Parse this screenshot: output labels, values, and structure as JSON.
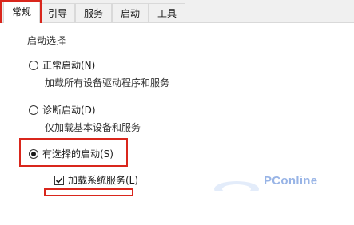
{
  "tabs": [
    {
      "label": "常规",
      "active": true
    },
    {
      "label": "引导"
    },
    {
      "label": "服务"
    },
    {
      "label": "启动"
    },
    {
      "label": "工具"
    }
  ],
  "startup_group": {
    "title": "启动选择",
    "options": [
      {
        "label": "正常启动(N)",
        "description": "加载所有设备驱动程序和服务",
        "checked": false
      },
      {
        "label": "诊断启动(D)",
        "description": "仅加载基本设备和服务",
        "checked": false
      },
      {
        "label": "有选择的启动(S)",
        "checked": true
      }
    ],
    "sub_options": [
      {
        "label": "加载系统服务(L)",
        "checked": true
      }
    ]
  },
  "watermark": {
    "text": "PConline"
  },
  "colors": {
    "highlight": "#d9261c",
    "watermark": "#98b4e6"
  }
}
